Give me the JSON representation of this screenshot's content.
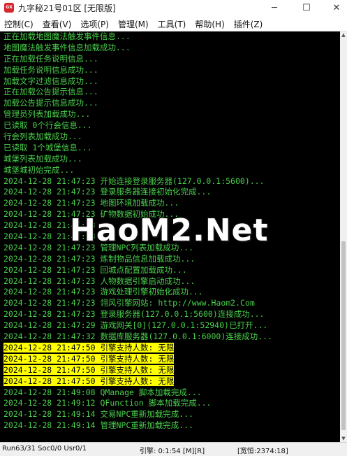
{
  "window": {
    "icon_label": "GX",
    "title": "九字秘21号01区 [无限版]",
    "minimize": "─",
    "maximize": "☐",
    "close": "✕"
  },
  "menu": [
    {
      "label": "控制(C)"
    },
    {
      "label": "查看(V)"
    },
    {
      "label": "选项(P)"
    },
    {
      "label": "管理(M)"
    },
    {
      "label": "工具(T)"
    },
    {
      "label": "帮助(H)"
    },
    {
      "label": "插件(Z)"
    }
  ],
  "log": [
    {
      "text": "正在加载地图魔法触发事件信息...",
      "highlight": false
    },
    {
      "text": "地图魔法触发事件信息加载成功...",
      "highlight": false
    },
    {
      "text": "正在加载任务说明信息...",
      "highlight": false
    },
    {
      "text": "加载任务说明信息成功...",
      "highlight": false
    },
    {
      "text": "加载文字过滤信息成功...",
      "highlight": false
    },
    {
      "text": "正在加载公告提示信息...",
      "highlight": false
    },
    {
      "text": "加载公告提示信息成功...",
      "highlight": false
    },
    {
      "text": "管理员列表加载成功...",
      "highlight": false
    },
    {
      "text": "已读取 0个行会信息...",
      "highlight": false
    },
    {
      "text": "行会列表加载成功...",
      "highlight": false
    },
    {
      "text": "已读取 1个城堡信息...",
      "highlight": false
    },
    {
      "text": "城堡列表加载成功...",
      "highlight": false
    },
    {
      "text": "城堡城初始完成...",
      "highlight": false
    },
    {
      "text": "2024-12-28 21:47:23 开始连接登录服务器(127.0.0.1:5600)...",
      "highlight": false
    },
    {
      "text": "2024-12-28 21:47:23 登录服务器连接初始化完成...",
      "highlight": false
    },
    {
      "text": "2024-12-28 21:47:23 地图环境加载成功...",
      "highlight": false
    },
    {
      "text": "2024-12-28 21:47:23 矿物数据初始成功...",
      "highlight": false
    },
    {
      "text": "2024-12-28 21:47:23",
      "highlight": false
    },
    {
      "text": "2024-12-28 21:47:23",
      "highlight": false
    },
    {
      "text": "2024-12-28 21:47:23 管理NPC列表加载成功...",
      "highlight": false
    },
    {
      "text": "2024-12-28 21:47:23 炼制物品信息加载成功...",
      "highlight": false
    },
    {
      "text": "2024-12-28 21:47:23 回城点配置加载成功...",
      "highlight": false
    },
    {
      "text": "2024-12-28 21:47:23 人物数据引擎启动成功...",
      "highlight": false
    },
    {
      "text": "2024-12-28 21:47:23 游戏处理引擎初始化成功...",
      "highlight": false
    },
    {
      "text": "2024-12-28 21:47:23 翎风引擎网站: http://www.Haom2.Com",
      "highlight": false
    },
    {
      "text": "2024-12-28 21:47:23 登录服务器(127.0.0.1:5600)连接成功...",
      "highlight": false
    },
    {
      "text": "2024-12-28 21:47:29 游戏网关[0](127.0.0.1:52940)已打开...",
      "highlight": false
    },
    {
      "text": "2024-12-28 21:47:32 数据库服务器(127.0.0.1:6000)连接成功...",
      "highlight": false
    },
    {
      "text": "2024-12-28 21:47:50 引擎支持人数: 无限",
      "highlight": true
    },
    {
      "text": "2024-12-28 21:47:50 引擎支持人数: 无限",
      "highlight": true
    },
    {
      "text": "2024-12-28 21:47:50 引擎支持人数: 无限",
      "highlight": true
    },
    {
      "text": "2024-12-28 21:47:50 引擎支持人数: 无限",
      "highlight": true
    },
    {
      "text": "2024-12-28 21:49:08 QManage 脚本加载完成...",
      "highlight": false
    },
    {
      "text": "2024-12-28 21:49:12 QFunction 脚本加载完成...",
      "highlight": false
    },
    {
      "text": "2024-12-28 21:49:14 交易NPC重新加载完成...",
      "highlight": false
    },
    {
      "text": "2024-12-28 21:49:14 管理NPC重新加载完成...",
      "highlight": false
    }
  ],
  "watermark": "HaoM2.Net",
  "status": {
    "left": "Run63/31 Soc0/0 Usr0/1",
    "middle": "引擎: 0:1:54 [M][R]",
    "right": "[宽恒:2374:18]"
  },
  "colors": {
    "console_bg": "#000000",
    "console_text": "#49d14b",
    "highlight_bg": "#ffff00",
    "highlight_text": "#000000"
  }
}
